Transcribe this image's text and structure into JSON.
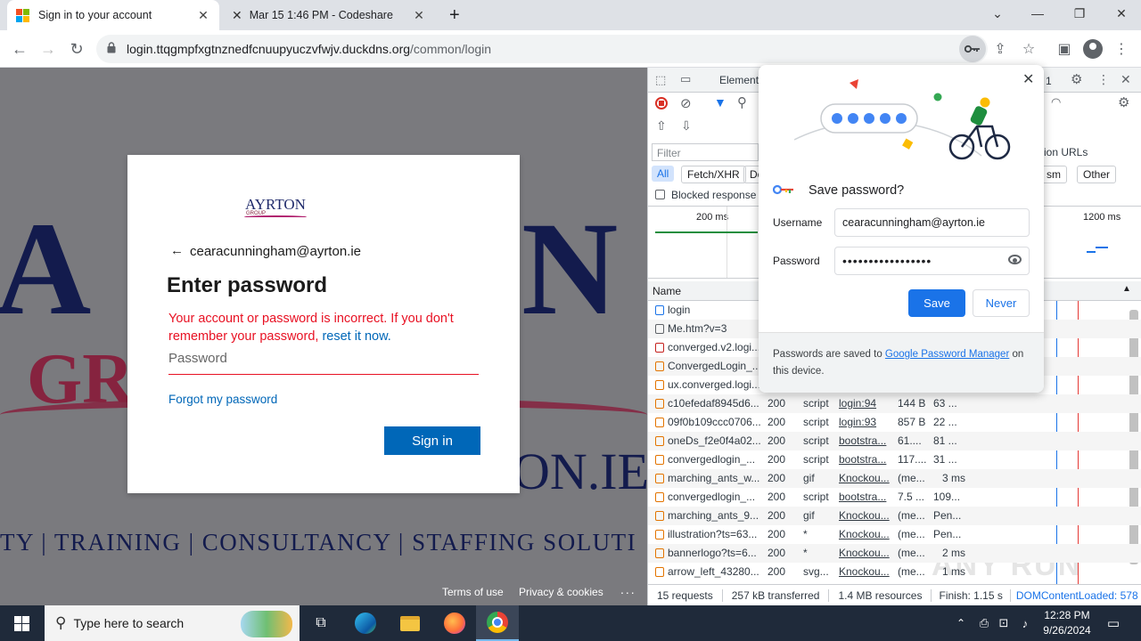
{
  "browser": {
    "tabs": [
      {
        "title": "Sign in to your account",
        "active": true
      },
      {
        "title": "Mar 15 1:46 PM - Codeshare",
        "active": false
      }
    ],
    "new_tab": "+",
    "url_host": "login.ttqgmpfxgtnznedfcnuupyuczvfwjv.duckdns.org",
    "url_path": "/common/login"
  },
  "page": {
    "bg_tagline": "TY | TRAINING | CONSULTANCY | STAFFING SOLUTI",
    "bg_domain": "ON.IE",
    "card": {
      "logo": "AYRTON",
      "logo_sub": "GROUP",
      "account": "cearacunningham@ayrton.ie",
      "heading": "Enter password",
      "error_text": "Your account or password is incorrect. If you don't remember your password, ",
      "error_link": "reset it now.",
      "password_placeholder": "Password",
      "forgot": "Forgot my password",
      "signin": "Sign in"
    },
    "footer": {
      "terms": "Terms of use",
      "privacy": "Privacy & cookies",
      "more": "..."
    }
  },
  "devtools": {
    "tab_elements": "Element",
    "tab_partial": "1",
    "filter_placeholder": "Filter",
    "invert_label": "ion URLs",
    "filter_types": [
      "All",
      "Fetch/XHR",
      "Do",
      "sm",
      "Other"
    ],
    "blocked_label": "Blocked response c",
    "timeline_labels": [
      "200 ms",
      "1200 ms"
    ],
    "name_header": "Name",
    "requests": [
      {
        "name": "login",
        "status": "",
        "type": "",
        "initiator": "",
        "size": "",
        "time": ""
      },
      {
        "name": "Me.htm?v=3",
        "status": "",
        "type": "",
        "initiator": "",
        "size": "",
        "time": ""
      },
      {
        "name": "converged.v2.logi...",
        "status": "",
        "type": "",
        "initiator": "",
        "size": "",
        "time": ""
      },
      {
        "name": "ConvergedLogin_...",
        "status": "",
        "type": "",
        "initiator": "",
        "size": "",
        "time": ""
      },
      {
        "name": "ux.converged.logi...",
        "status": "",
        "type": "",
        "initiator": "",
        "size": "",
        "time": ""
      },
      {
        "name": "c10efedaf8945d6...",
        "status": "200",
        "type": "script",
        "initiator": "login:94",
        "size": "144 B",
        "time": "63 ..."
      },
      {
        "name": "09f0b109ccc0706...",
        "status": "200",
        "type": "script",
        "initiator": "login:93",
        "size": "857 B",
        "time": "22 ..."
      },
      {
        "name": "oneDs_f2e0f4a02...",
        "status": "200",
        "type": "script",
        "initiator": "bootstra...",
        "size": "61....",
        "time": "81 ..."
      },
      {
        "name": "convergedlogin_...",
        "status": "200",
        "type": "script",
        "initiator": "bootstra...",
        "size": "117....",
        "time": "31 ..."
      },
      {
        "name": "marching_ants_w...",
        "status": "200",
        "type": "gif",
        "initiator": "Knockou...",
        "size": "(me...",
        "time": "3 ms"
      },
      {
        "name": "convergedlogin_...",
        "status": "200",
        "type": "script",
        "initiator": "bootstra...",
        "size": "7.5 ...",
        "time": "109..."
      },
      {
        "name": "marching_ants_9...",
        "status": "200",
        "type": "gif",
        "initiator": "Knockou...",
        "size": "(me...",
        "time": "Pen..."
      },
      {
        "name": "illustration?ts=63...",
        "status": "200",
        "type": "*",
        "initiator": "Knockou...",
        "size": "(me...",
        "time": "Pen..."
      },
      {
        "name": "bannerlogo?ts=6...",
        "status": "200",
        "type": "*",
        "initiator": "Knockou...",
        "size": "(me...",
        "time": "2 ms"
      },
      {
        "name": "arrow_left_43280...",
        "status": "200",
        "type": "svg...",
        "initiator": "Knockou...",
        "size": "(me...",
        "time": "1 ms"
      }
    ],
    "status_bar": {
      "requests": "15 requests",
      "transferred": "257 kB transferred",
      "resources": "1.4 MB resources",
      "finish": "Finish: 1.15 s",
      "dcl": "DOMContentLoaded: 578 ms"
    },
    "watermark": "ANY RUN"
  },
  "password_popup": {
    "title": "Save password?",
    "username_label": "Username",
    "username_value": "cearacunningham@ayrton.ie",
    "password_label": "Password",
    "password_value": "•••••••••••••••••",
    "save": "Save",
    "never": "Never",
    "footer_text": "Passwords are saved to ",
    "footer_link": "Google Password Manager",
    "footer_tail": " on this device."
  },
  "taskbar": {
    "search_placeholder": "Type here to search",
    "time": "12:28 PM",
    "date": "9/26/2024"
  },
  "colors": {
    "accent": "#1a73e8",
    "error": "#e81123",
    "signin": "#0067b8"
  }
}
